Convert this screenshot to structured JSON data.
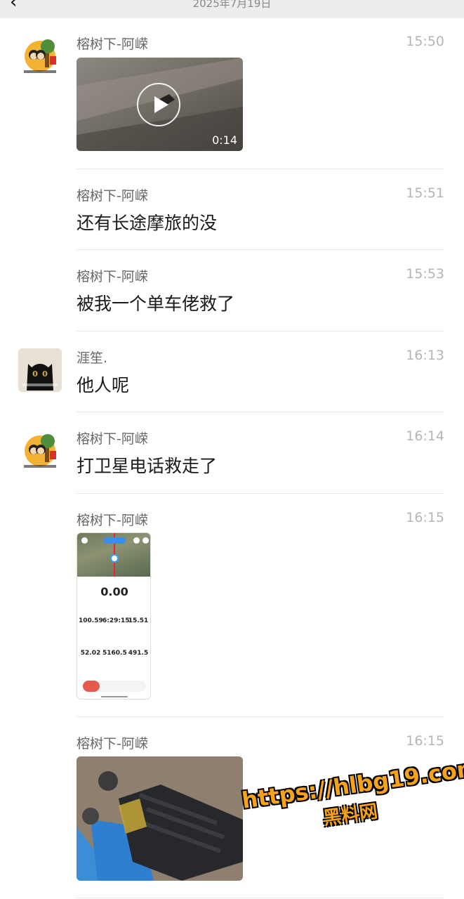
{
  "header": {
    "back_icon": "chevron-left-icon",
    "date": "2025年7月19日"
  },
  "messages": [
    {
      "name": "榕树下-阿嵘",
      "time": "15:50",
      "type": "video",
      "duration": "0:14"
    },
    {
      "name": "榕树下-阿嵘",
      "time": "15:51",
      "type": "text",
      "text": "还有长途摩旅的没"
    },
    {
      "name": "榕树下-阿嵘",
      "time": "15:53",
      "type": "text",
      "text": "被我一个单车佬救了"
    },
    {
      "name": "涯笙.",
      "time": "16:13",
      "type": "text",
      "text": "他人呢"
    },
    {
      "name": "榕树下-阿嵘",
      "time": "16:14",
      "type": "text",
      "text": "打卫星电话救走了"
    },
    {
      "name": "榕树下-阿嵘",
      "time": "16:15",
      "type": "image",
      "image": "ride-tracker-screenshot",
      "tracker": {
        "main": "0.00",
        "stats": [
          "100.59",
          "6:29:15",
          "15.51",
          "52.02",
          "5160.5",
          "491.5"
        ]
      }
    },
    {
      "name": "榕树下-阿嵘",
      "time": "16:15",
      "type": "image",
      "image": "rescue-photo"
    }
  ],
  "watermark": {
    "url": "https://hlbg19.com",
    "text": "黑料网"
  },
  "colors": {
    "name": "#666666",
    "time": "#b5b5b5",
    "divider": "#e6e6e6",
    "watermark": "#f7a21b"
  }
}
